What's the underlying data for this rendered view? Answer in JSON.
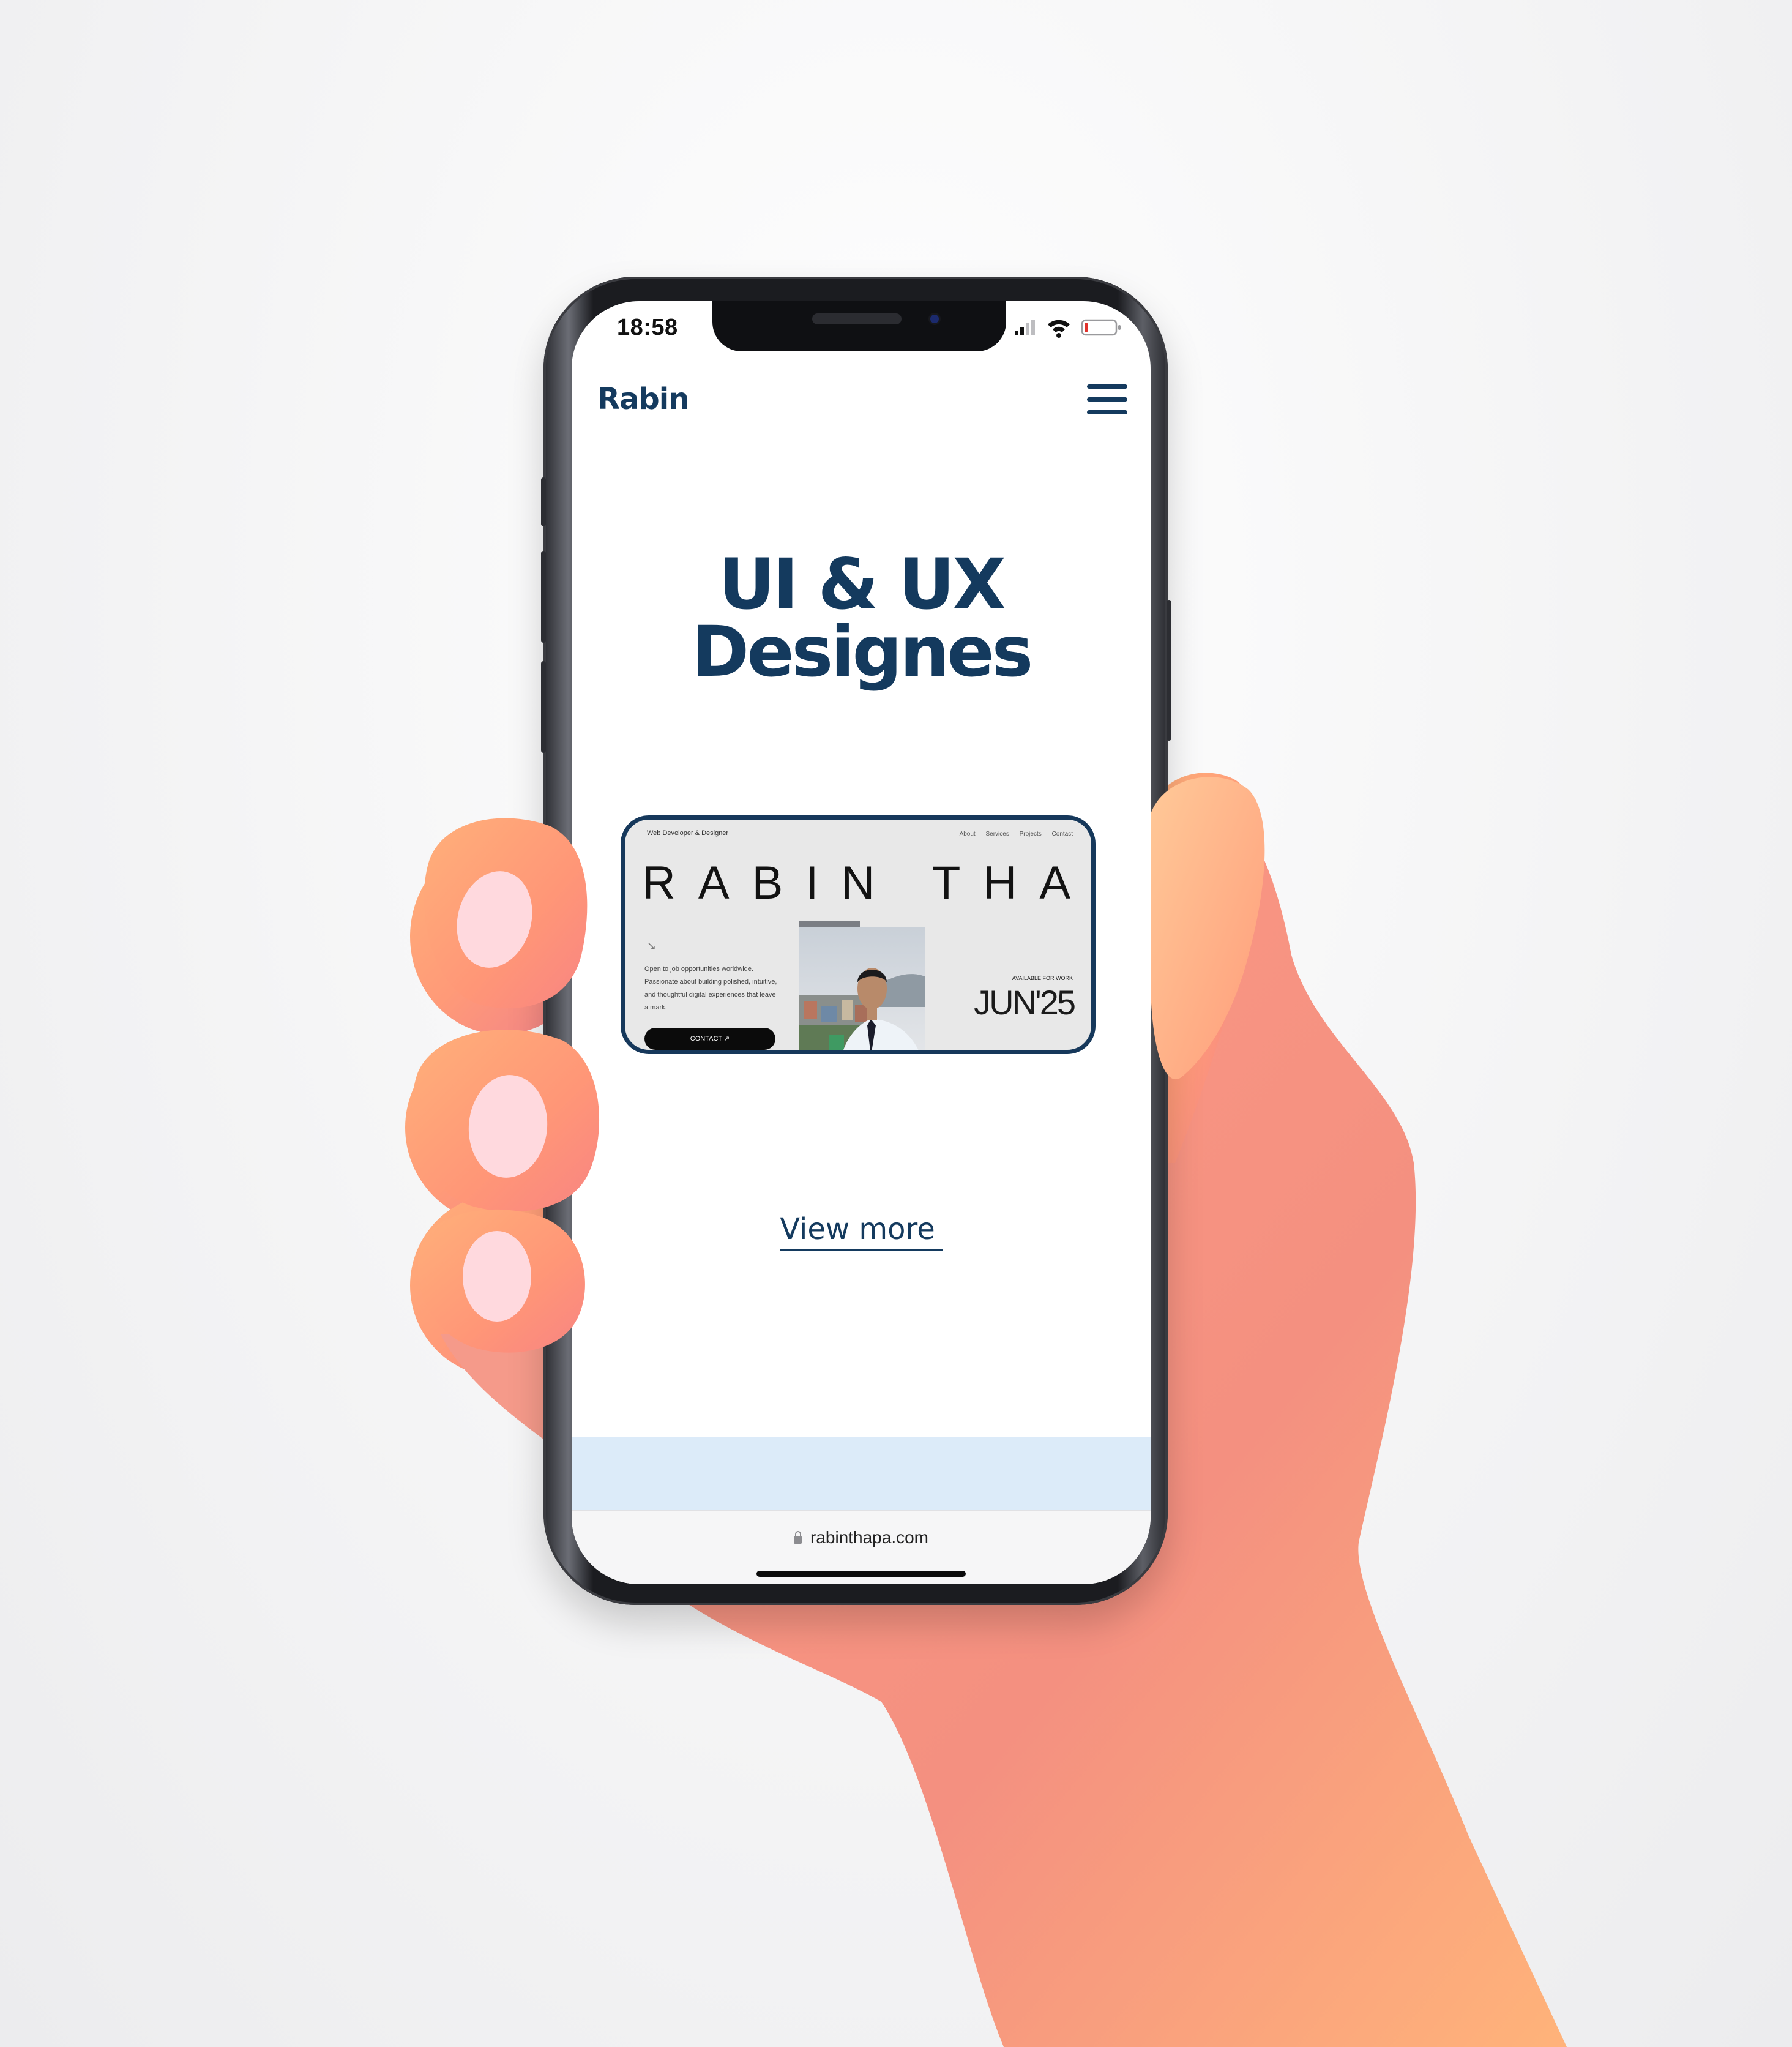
{
  "status_bar": {
    "time": "18:58"
  },
  "header": {
    "brand": "Rabin"
  },
  "hero": {
    "line1": "UI & UX",
    "line2": "Designes"
  },
  "preview_card": {
    "tagline": "Web Developer & Designer",
    "nav": [
      "About",
      "Services",
      "Projects",
      "Contact"
    ],
    "name": "RABIN THAPA",
    "arrow": "↘",
    "description": "Open to job opportunities worldwide. Passionate about building polished, intuitive, and thoughtful digital experiences that leave a mark.",
    "contact_label": "CONTACT ↗",
    "availability_label": "AVAILABLE FOR WORK",
    "availability_date": "JUN'25"
  },
  "cta": {
    "view_more": "View more"
  },
  "browser": {
    "url": "rabinthapa.com"
  },
  "colors": {
    "brand": "#143a5e",
    "band": "#dcebf9",
    "background": "#f0f0f2"
  },
  "icons": [
    "hamburger-menu-icon",
    "signal-icon",
    "wifi-icon",
    "battery-icon",
    "lock-icon"
  ]
}
